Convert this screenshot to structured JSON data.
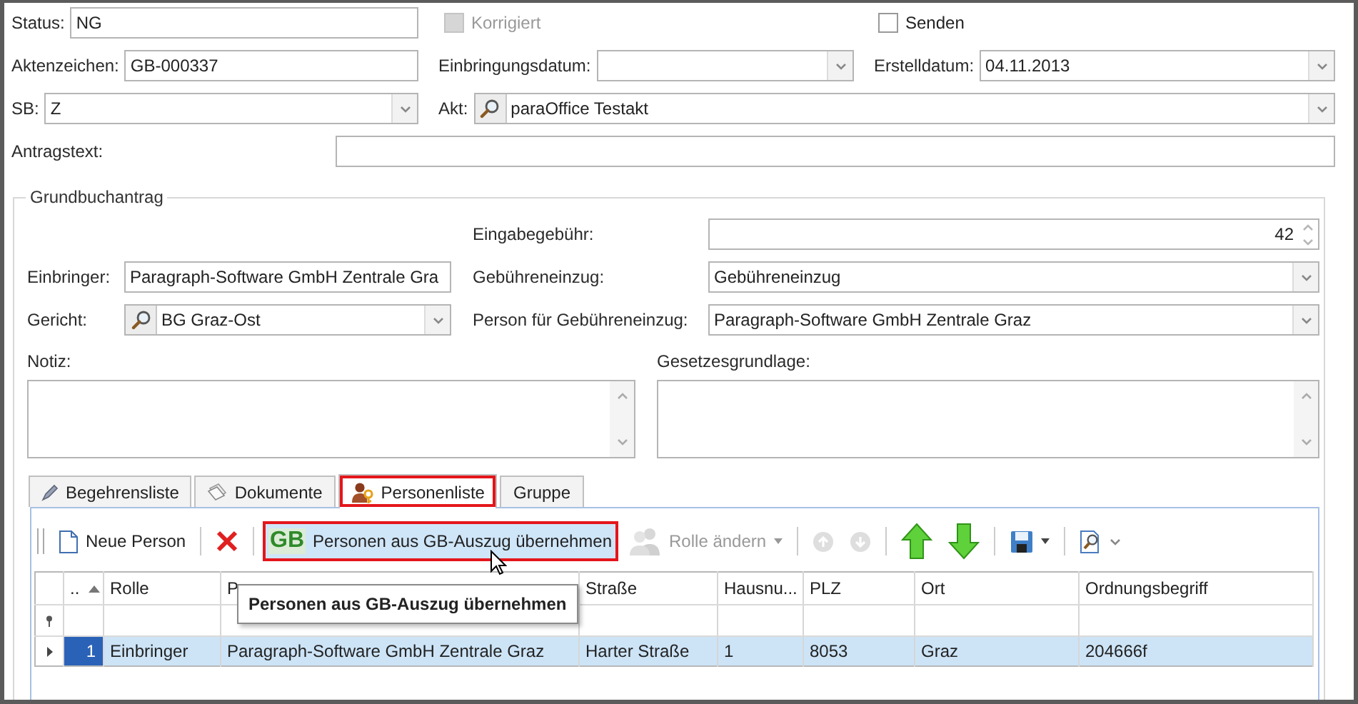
{
  "top": {
    "status": {
      "label": "Status:",
      "field": {
        "kind": "text",
        "value": "NG"
      }
    },
    "korrigiert": {
      "label": "Korrigiert",
      "checked": false,
      "disabled": true
    },
    "senden": {
      "label": "Senden",
      "checked": false,
      "disabled": false
    },
    "aktenzeichen": {
      "label": "Aktenzeichen:",
      "field": {
        "kind": "text",
        "value": "GB-000337"
      }
    },
    "einbringungsdatum": {
      "label": "Einbringungsdatum:",
      "field": {
        "kind": "dropdown"
      }
    },
    "erstelldatum": {
      "label": "Erstelldatum:",
      "field": {
        "kind": "dropdown",
        "value": "04.11.2013"
      }
    },
    "sb": {
      "label": "SB:",
      "field": {
        "kind": "dropdown",
        "value": "Z"
      }
    },
    "akt": {
      "label": "Akt:",
      "field": {
        "kind": "lookup-dropdown",
        "value": "paraOffice Testakt"
      }
    },
    "antragstext": {
      "label": "Antragstext:",
      "field": {
        "kind": "text"
      }
    }
  },
  "group": {
    "title": "Grundbuchantrag",
    "eingabegebuehr": {
      "label": "Eingabegebühr:",
      "field": {
        "kind": "spin",
        "value": "42"
      }
    },
    "einbringer": {
      "label": "Einbringer:",
      "field": {
        "kind": "text",
        "value": "Paragraph-Software GmbH Zentrale Gra"
      }
    },
    "gebuehreneinzug": {
      "label": "Gebühreneinzug:",
      "field": {
        "kind": "dropdown",
        "value": "Gebühreneinzug"
      }
    },
    "gericht": {
      "label": "Gericht:",
      "field": {
        "kind": "lookup-dropdown",
        "value": "BG Graz-Ost"
      }
    },
    "person": {
      "label": "Person für Gebühreneinzug:",
      "field": {
        "kind": "dropdown",
        "value": "Paragraph-Software GmbH Zentrale Graz"
      }
    },
    "notiz": {
      "label": "Notiz:",
      "field": {
        "kind": "memo"
      }
    },
    "gesetzesgrundlage": {
      "label": "Gesetzesgrundlage:",
      "field": {
        "kind": "memo"
      }
    }
  },
  "tabs": [
    {
      "kind": "begehren",
      "label": "Begehrensliste",
      "selected": false,
      "annotated": false
    },
    {
      "kind": "dokumente",
      "label": "Dokumente",
      "selected": false,
      "annotated": false
    },
    {
      "kind": "personen",
      "label": "Personenliste",
      "selected": true,
      "annotated": true
    },
    {
      "kind": "plain",
      "label": "Gruppe",
      "selected": false,
      "annotated": false
    }
  ],
  "toolbar": {
    "groups": [
      [
        {
          "kind": "new",
          "label": "Neue Person",
          "disabled": false
        }
      ],
      [
        {
          "kind": "delete",
          "disabled": false
        }
      ],
      [
        {
          "kind": "import",
          "icon_text": "GB",
          "label": "Personen aus GB-Auszug übernehmen",
          "disabled": false,
          "hovered": true,
          "annotated": true
        },
        {
          "kind": "role",
          "label": "Rolle ändern",
          "disabled": true,
          "dropdown": true
        }
      ],
      [
        {
          "kind": "round-up",
          "disabled": true
        },
        {
          "kind": "round-down",
          "disabled": true
        }
      ],
      [
        {
          "kind": "up",
          "disabled": false
        },
        {
          "kind": "down",
          "disabled": false
        }
      ],
      [
        {
          "kind": "save",
          "disabled": false,
          "dropdown": true
        }
      ],
      [
        {
          "kind": "find",
          "disabled": false,
          "dropdown": true
        }
      ]
    ]
  },
  "grid": {
    "columns": [
      {
        "label": "..",
        "sorted": true
      },
      {
        "label": "Rolle"
      },
      {
        "label": "P"
      },
      {
        "label": "Straße"
      },
      {
        "label": "Hausnu..."
      },
      {
        "label": "PLZ"
      },
      {
        "label": "Ort"
      },
      {
        "label": "Ordnungsbegriff"
      }
    ],
    "rows": [
      {
        "selected": true,
        "first_cell_focused": true,
        "cells": [
          "1",
          "Einbringer",
          "Paragraph-Software GmbH Zentrale Graz",
          "Harter Straße",
          "1",
          "8053",
          "Graz",
          "204666f"
        ]
      }
    ]
  },
  "tooltip": {
    "text": "Personen aus GB-Auszug übernehmen"
  }
}
